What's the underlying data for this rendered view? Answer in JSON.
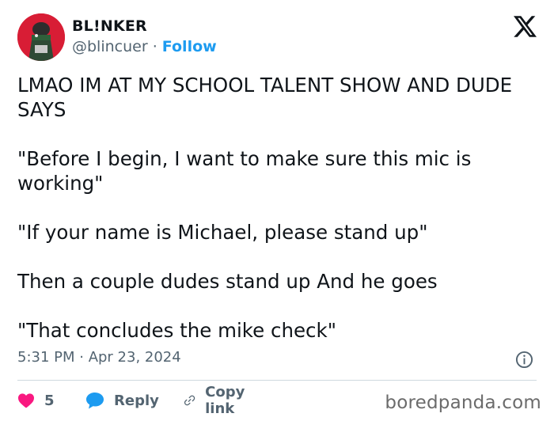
{
  "author": {
    "name": "BL!NKER",
    "handle": "@blincuer",
    "separator": "·",
    "follow_label": "Follow"
  },
  "tweet": {
    "paragraphs": [
      "LMAO IM AT MY SCHOOL TALENT SHOW AND DUDE SAYS",
      "\"Before I begin, I want to make sure this mic is working\"",
      "\"If your name is Michael, please stand up\"",
      "Then a couple dudes stand up And he goes",
      "\"That concludes the mike check\""
    ]
  },
  "meta": {
    "timestamp": "5:31 PM · Apr 23, 2024"
  },
  "actions": {
    "like_count": "5",
    "reply_label": "Reply",
    "copy_link_label": "Copy link"
  },
  "watermark": "boredpanda.com",
  "colors": {
    "text": "#0f1419",
    "muted": "#536471",
    "accent_blue": "#1d9bf0",
    "heart_red": "#f91880",
    "avatar_red": "#d81d35"
  },
  "icons": {
    "brand": "x-logo-icon",
    "info": "info-icon",
    "like": "heart-icon",
    "reply": "reply-bubble-icon",
    "copy": "link-icon"
  }
}
